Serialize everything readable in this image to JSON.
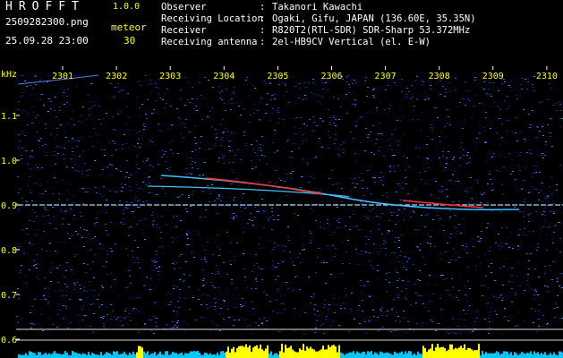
{
  "app": {
    "title": "HROFFT",
    "version": "1.0.0"
  },
  "file": {
    "name": "2509282300.png",
    "datetime": "25.09.28 23:00"
  },
  "meteor": {
    "label": "meteor",
    "count": "30"
  },
  "info": [
    {
      "key": "Observer",
      "value": "Takanori Kawachi"
    },
    {
      "key": "Receiving Location",
      "value": "Ogaki, Gifu, JAPAN (136.60E, 35.35N)"
    },
    {
      "key": "Receiver",
      "value": "R820T2(RTL-SDR) SDR-Sharp 53.372MHz"
    },
    {
      "key": "Receiving antenna",
      "value": "2el-HB9CV Vertical (el. E-W)"
    }
  ],
  "axis": {
    "unit": "kHz",
    "y_ticks": [
      "1.1",
      "1.0",
      "0.9",
      "0.8",
      "0.7",
      "0.6"
    ],
    "x_ticks": [
      "2301",
      "2302",
      "2303",
      "2304",
      "2305",
      "2306",
      "2307",
      "2308",
      "2309",
      "2310"
    ]
  },
  "colors": {
    "background": "#000000",
    "noise": "#0a1a6e",
    "label": "#ffff00",
    "tick": "#ffffff",
    "signal": "#ff3030",
    "carrier": "#9fd8ff",
    "bars": "#00c8ff"
  }
}
